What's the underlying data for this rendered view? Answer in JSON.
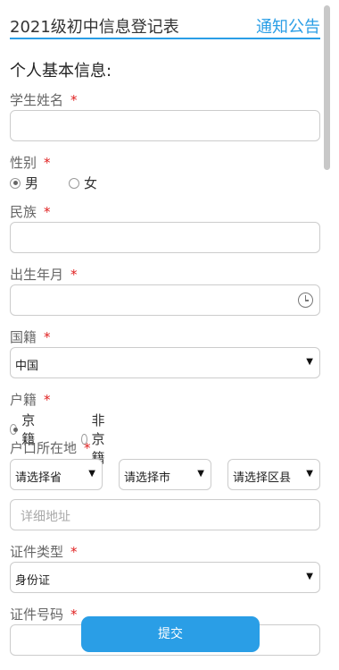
{
  "header": {
    "title": "2021级初中信息登记表",
    "notice": "通知公告"
  },
  "section_title": "个人基本信息:",
  "fields": {
    "name": {
      "label": "学生姓名",
      "required": "*"
    },
    "gender": {
      "label": "性别",
      "required": "*",
      "options": [
        "男",
        "女"
      ],
      "selected": "男"
    },
    "ethnicity": {
      "label": "民族",
      "required": "*"
    },
    "birth": {
      "label": "出生年月",
      "required": "*"
    },
    "nationality": {
      "label": "国籍",
      "required": "*",
      "value": "中国"
    },
    "household": {
      "label": "户籍",
      "required": "*",
      "options": [
        "京籍",
        "非京籍"
      ],
      "selected": "京籍"
    },
    "household_location": {
      "label": "户口所在地",
      "required": "*",
      "province_placeholder": "请选择省",
      "city_placeholder": "请选择市",
      "district_placeholder": "请选择区县",
      "address_placeholder": "详细地址"
    },
    "id_type": {
      "label": "证件类型",
      "required": "*",
      "value": "身份证"
    },
    "id_number": {
      "label": "证件号码",
      "required": "*"
    }
  },
  "submit_label": "提交",
  "icons": {
    "dropdown": "triangle-down",
    "time": "clock-icon"
  }
}
